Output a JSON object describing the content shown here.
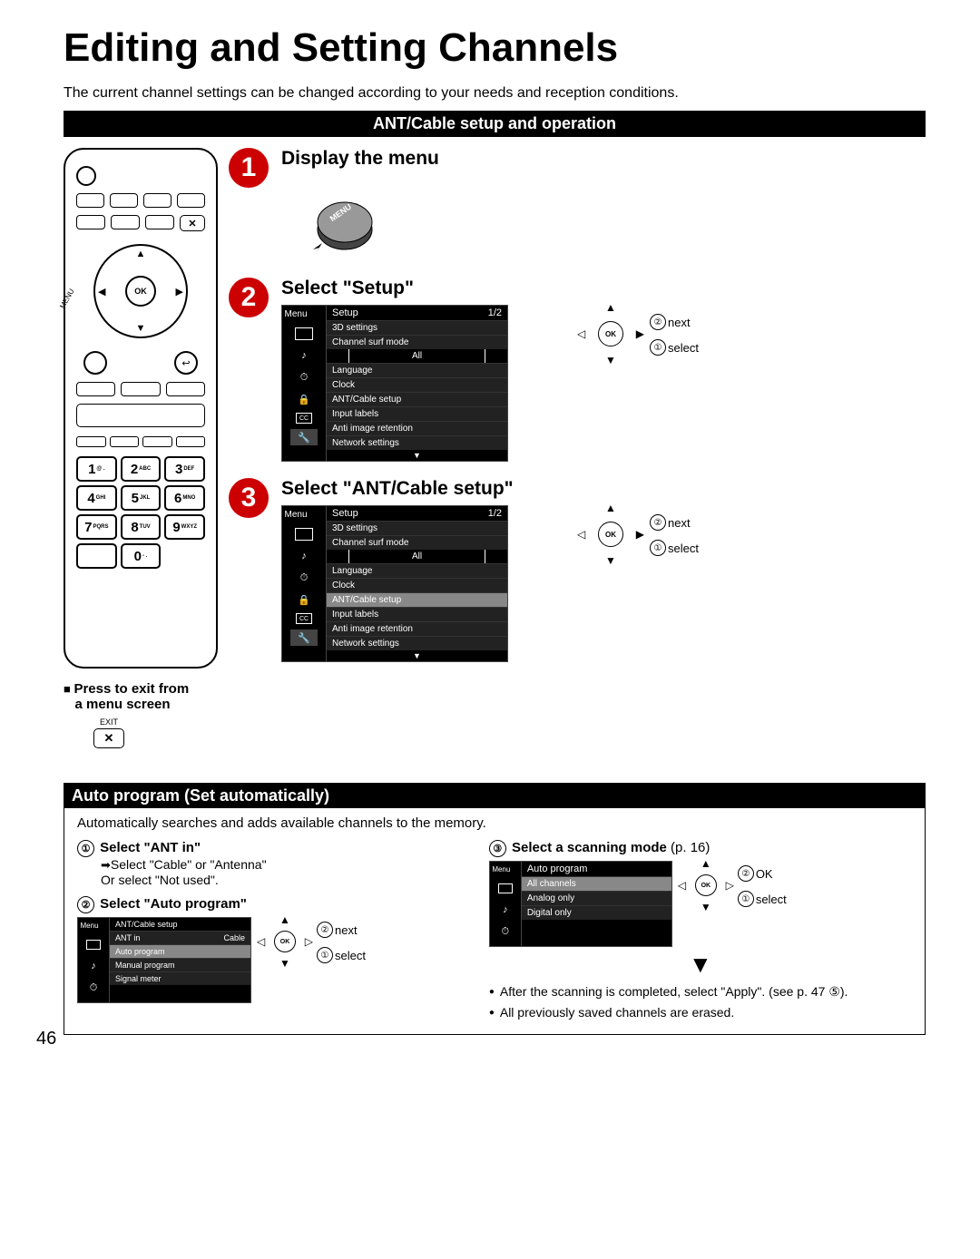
{
  "title": "Editing and Setting Channels",
  "intro": "The current channel settings can be changed according to your needs and reception conditions.",
  "section_bar": "ANT/Cable setup and operation",
  "steps": {
    "s1": {
      "num": "1",
      "title": "Display the menu",
      "menu_label": "MENU"
    },
    "s2": {
      "num": "2",
      "title": "Select \"Setup\""
    },
    "s3": {
      "num": "3",
      "title": "Select \"ANT/Cable setup\""
    }
  },
  "menu_common": {
    "menu": "Menu",
    "setup": "Setup",
    "page": "1/2",
    "items": {
      "i0": "3D settings",
      "i1": "Channel surf mode",
      "i1v": "All",
      "i2": "Language",
      "i3": "Clock",
      "i4": "ANT/Cable setup",
      "i5": "Input labels",
      "i6": "Anti image retention",
      "i7": "Network settings"
    }
  },
  "nav": {
    "ok": "OK",
    "next": "next",
    "select": "select",
    "ok_label": "OK"
  },
  "remote": {
    "ok": "OK",
    "menu": "MENU",
    "keys": {
      "k1": "1",
      "k1s": "@ .",
      "k2": "2",
      "k2s": "ABC",
      "k3": "3",
      "k3s": "DEF",
      "k4": "4",
      "k4s": "GHI",
      "k5": "5",
      "k5s": "JKL",
      "k6": "6",
      "k6s": "MNO",
      "k7": "7",
      "k7s": "PQRS",
      "k8": "8",
      "k8s": "TUV",
      "k9": "9",
      "k9s": "WXYZ",
      "k0": "0",
      "k0s": "- ."
    }
  },
  "exit_note": {
    "line1": "Press to exit from",
    "line2": "a menu screen",
    "exit": "EXIT"
  },
  "auto": {
    "header": "Auto program (Set automatically)",
    "desc": "Automatically searches and adds available channels to the memory.",
    "step1": "Select \"ANT in\"",
    "step1a": "Select \"Cable\" or \"Antenna\"",
    "step1b": "Or select \"Not used\".",
    "step2": "Select \"Auto program\"",
    "step3": "Select a scanning mode",
    "step3p": "(p. 16)",
    "mini1": {
      "title": "ANT/Cable setup",
      "r1a": "ANT in",
      "r1b": "Cable",
      "r2": "Auto program",
      "r3": "Manual program",
      "r4": "Signal meter"
    },
    "mini2": {
      "title": "Auto program",
      "r1": "All channels",
      "r2": "Analog only",
      "r3": "Digital only"
    },
    "bullet1": "After the scanning is completed, select \"Apply\". (see p. 47 ⑤).",
    "bullet2": "All previously saved channels are erased."
  },
  "page_number": "46"
}
